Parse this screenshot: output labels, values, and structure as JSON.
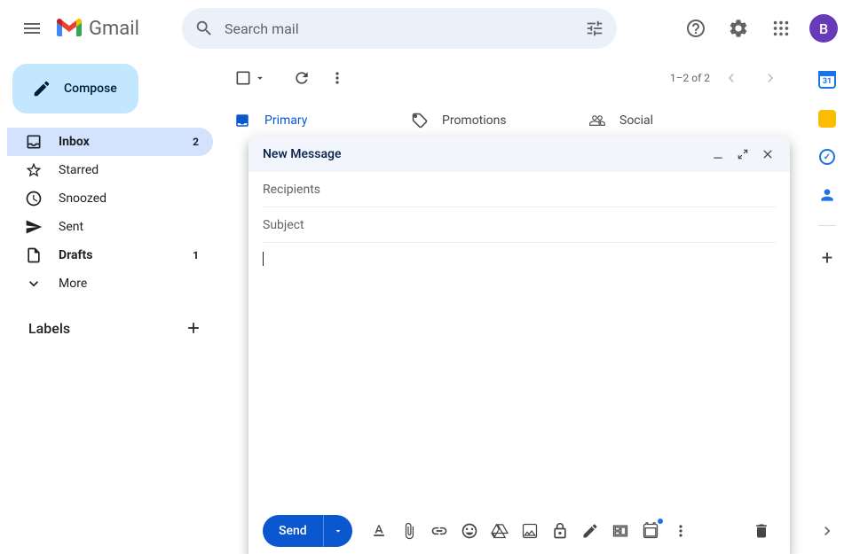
{
  "header": {
    "app_name": "Gmail",
    "search_placeholder": "Search mail",
    "avatar_initial": "B"
  },
  "sidebar": {
    "compose_label": "Compose",
    "items": [
      {
        "label": "Inbox",
        "badge": "2"
      },
      {
        "label": "Starred",
        "badge": ""
      },
      {
        "label": "Snoozed",
        "badge": ""
      },
      {
        "label": "Sent",
        "badge": ""
      },
      {
        "label": "Drafts",
        "badge": "1"
      },
      {
        "label": "More",
        "badge": ""
      }
    ],
    "labels_heading": "Labels"
  },
  "toolbar": {
    "page_info": "1–2 of 2"
  },
  "tabs": [
    {
      "label": "Primary"
    },
    {
      "label": "Promotions"
    },
    {
      "label": "Social"
    }
  ],
  "right_panel": {
    "calendar_day": "31"
  },
  "compose": {
    "title": "New Message",
    "recipients_placeholder": "Recipients",
    "subject_placeholder": "Subject",
    "send_label": "Send"
  }
}
